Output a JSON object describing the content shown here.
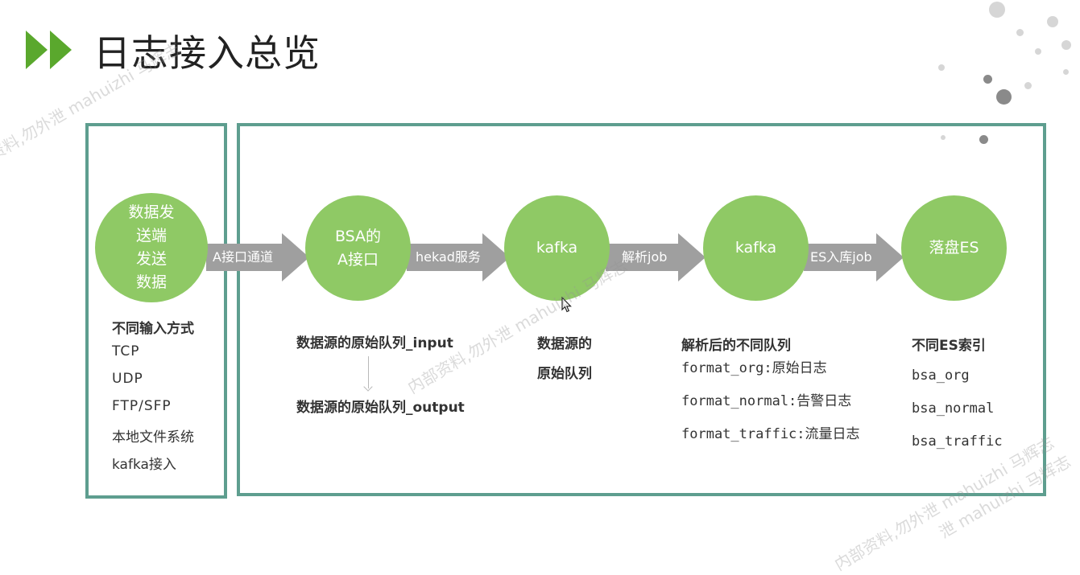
{
  "title": "日志接入总览",
  "colors": {
    "accent_green": "#5aa82d",
    "frame": "#5e9e8f",
    "node_fill": "#8fc965",
    "arrow": "#9f9f9f"
  },
  "nodes": [
    {
      "label": "数据发送端发送数据",
      "lines": [
        "数据发",
        "送端",
        "发送",
        "数据"
      ]
    },
    {
      "label": "BSA的A接口",
      "lines": [
        "BSA的",
        "A接口"
      ]
    },
    {
      "label": "kafka",
      "lines": [
        "kafka"
      ]
    },
    {
      "label": "kafka",
      "lines": [
        "kafka"
      ]
    },
    {
      "label": "落盘ES",
      "lines": [
        "落盘ES"
      ]
    }
  ],
  "arrows": [
    "A接口通道",
    "hekad服务",
    "解析job",
    "ES入库job"
  ],
  "input_methods": {
    "heading": "不同输入方式",
    "items": [
      "TCP",
      "UDP",
      "FTP/SFP",
      "本地文件系统",
      "kafka接入"
    ]
  },
  "source_queue": {
    "input": "数据源的原始队列_input",
    "output": "数据源的原始队列_output"
  },
  "raw_queue": {
    "line1": "数据源的",
    "line2": "原始队列"
  },
  "parsed_queues": {
    "heading": "解析后的不同队列",
    "items": [
      "format_org:原始日志",
      "format_normal:告警日志",
      "format_traffic:流量日志"
    ]
  },
  "es_indexes": {
    "heading": "不同ES索引",
    "items": [
      "bsa_org",
      "bsa_normal",
      "bsa_traffic"
    ]
  },
  "watermarks": [
    "资料,勿外泄 mahuizhi 马辉志",
    "内部资料,勿外泄 mahuizhi 马辉志",
    "内部资料,勿外泄 mahuizhi 马辉志",
    "泄 mahuizhi 马辉志"
  ]
}
